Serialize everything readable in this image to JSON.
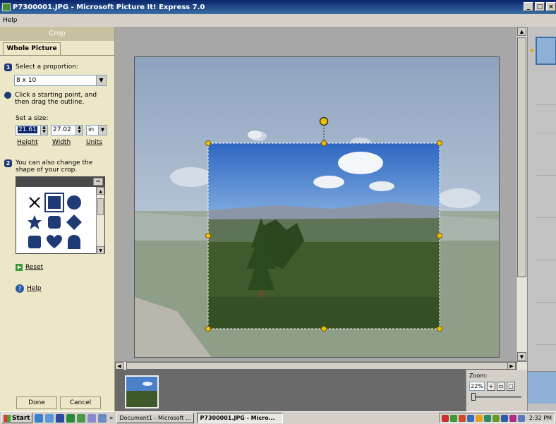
{
  "window": {
    "title": "P7300001.JPG - Microsoft Picture It! Express 7.0",
    "controls": [
      "_",
      "□",
      "×"
    ]
  },
  "menu": {
    "help": "Help"
  },
  "panel": {
    "header": "Crop",
    "tab": "Whole Picture",
    "step1": {
      "num": "1",
      "text": "Select a proportion:",
      "value": "8 x 10"
    },
    "step_drag": {
      "line1": "Click a starting point, and",
      "line2": "then drag the outline."
    },
    "size": {
      "label": "Set a size:",
      "height": "21.61",
      "width": "27.02",
      "units": "in",
      "height_label": "Height",
      "width_label": "Width",
      "units_label": "Units"
    },
    "step2": {
      "num": "2",
      "line1": "You can also change the",
      "line2": "shape of your crop."
    },
    "reset": "Reset",
    "help": "Help",
    "done": "Done",
    "cancel": "Cancel"
  },
  "zoom": {
    "label": "Zoom:",
    "value": "22%"
  },
  "taskbar": {
    "start": "Start",
    "chevron": "»",
    "task1": "Document1 - Microsoft ...",
    "task2": "P7300001.JPG - Micro...",
    "clock": "2:32 PM"
  },
  "colors": {
    "title_bar": "#0a246a",
    "panel_bg": "#ece7c7",
    "step_badge": "#1f3b75",
    "crop_handle": "#f2c200"
  }
}
